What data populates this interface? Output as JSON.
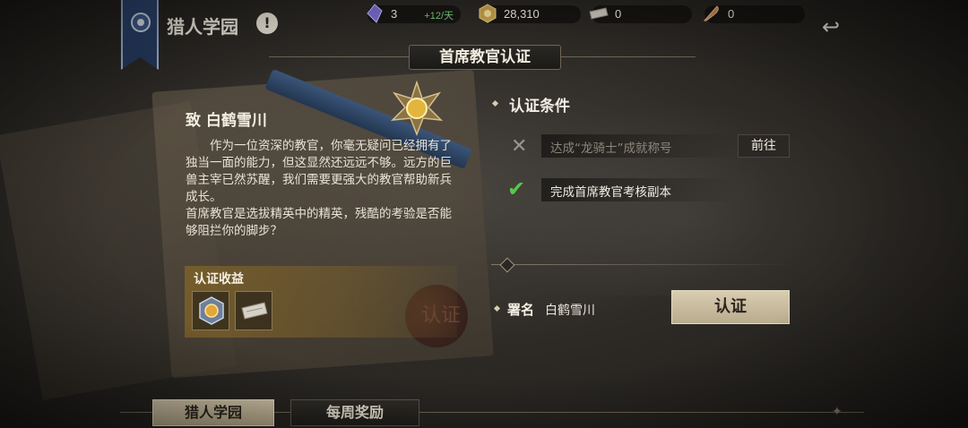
{
  "header": {
    "title": "猎人学园",
    "info_glyph": "!",
    "back_glyph": "↩"
  },
  "resources": [
    {
      "icon": "crystal-icon",
      "value": "3",
      "rate": "+12/天"
    },
    {
      "icon": "gold-coin-icon",
      "value": "28,310"
    },
    {
      "icon": "ticket-icon",
      "value": "0"
    },
    {
      "icon": "feather-icon",
      "value": "0"
    }
  ],
  "section_title": "首席教官认证",
  "letter": {
    "to": "致 白鹤雪川",
    "para1": "作为一位资深的教官，你毫无疑问已经拥有了独当一面的能力，但这显然还远远不够。远方的巨兽主宰已然苏醒，我们需要更强大的教官帮助新兵成长。",
    "para2": "首席教官是选拔精英中的精英，残酷的考验是否能够阻拦你的脚步？",
    "seal_text": "认证"
  },
  "benefits": {
    "title": "认证收益",
    "items": [
      {
        "icon": "badge-medal-icon"
      },
      {
        "icon": "ticket-icon"
      }
    ]
  },
  "conditions": {
    "title": "认证条件",
    "items": [
      {
        "text": "达成“龙骑士”成就称号",
        "done": false,
        "action": "前往"
      },
      {
        "text": "完成首席教官考核副本",
        "done": true
      }
    ]
  },
  "signature": {
    "label": "署名",
    "name": "白鹤雪川"
  },
  "certify_button": "认证",
  "tabs": [
    {
      "label": "猎人学园",
      "active": true
    },
    {
      "label": "每周奖励",
      "active": false
    }
  ],
  "colors": {
    "accent_gold": "#b9ab8d",
    "check_green": "#57c84a",
    "rate_green": "#7ad07a",
    "banner_blue": "#2f4a78"
  }
}
